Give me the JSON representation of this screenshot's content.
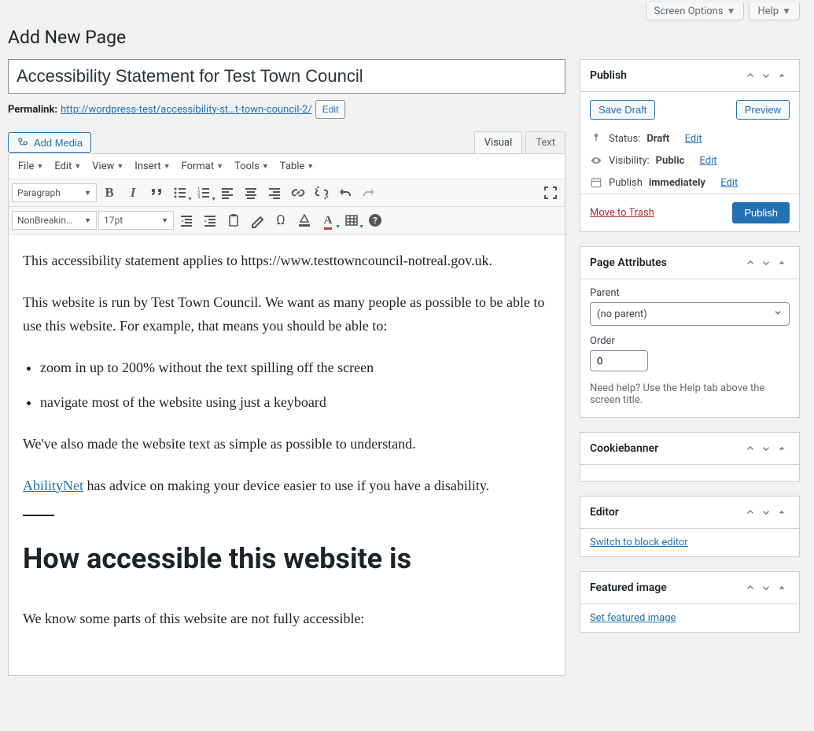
{
  "top": {
    "screen_options": "Screen Options",
    "help": "Help"
  },
  "heading": "Add New Page",
  "title_value": "Accessibility Statement for Test Town Council",
  "permalink": {
    "label": "Permalink:",
    "base": "http://wordpress-test/",
    "slug": "accessibility-st…t-town-council-2/",
    "edit": "Edit"
  },
  "add_media": "Add Media",
  "tabs": {
    "visual": "Visual",
    "text": "Text"
  },
  "menubar": [
    "File",
    "Edit",
    "View",
    "Insert",
    "Format",
    "Tools",
    "Table"
  ],
  "dropdowns": {
    "paragraph": "Paragraph",
    "font": "NonBreakin…",
    "size": "17pt"
  },
  "content": {
    "p1": "This accessibility statement applies to https://www.testtowncouncil-notreal.gov.uk.",
    "p2": "This website is run by Test Town Council. We want as many people as possible to be able to use this website. For example, that means you should be able to:",
    "li1": "zoom in up to 200% without the text spilling off the screen",
    "li2": "navigate most of the website using just a keyboard",
    "p3": "We've also made the website text as simple as possible to understand.",
    "link_text": "AbilityNet",
    "p4_rest": " has advice on making your device easier to use if you have a disability.",
    "h2": "How accessible this website is",
    "p5": "We know some parts of this website are not fully accessible:"
  },
  "publish": {
    "title": "Publish",
    "save_draft": "Save Draft",
    "preview": "Preview",
    "status_label": "Status: ",
    "status_value": "Draft",
    "visibility_label": "Visibility: ",
    "visibility_value": "Public",
    "publish_label": "Publish ",
    "publish_value": "immediately",
    "edit": "Edit",
    "trash": "Move to Trash",
    "publish_btn": "Publish"
  },
  "attrs": {
    "title": "Page Attributes",
    "parent_label": "Parent",
    "parent_value": "(no parent)",
    "order_label": "Order",
    "order_value": "0",
    "help": "Need help? Use the Help tab above the screen title."
  },
  "cookiebanner": {
    "title": "Cookiebanner"
  },
  "editor_panel": {
    "title": "Editor",
    "switch": "Switch to block editor"
  },
  "featured": {
    "title": "Featured image",
    "set": "Set featured image"
  }
}
